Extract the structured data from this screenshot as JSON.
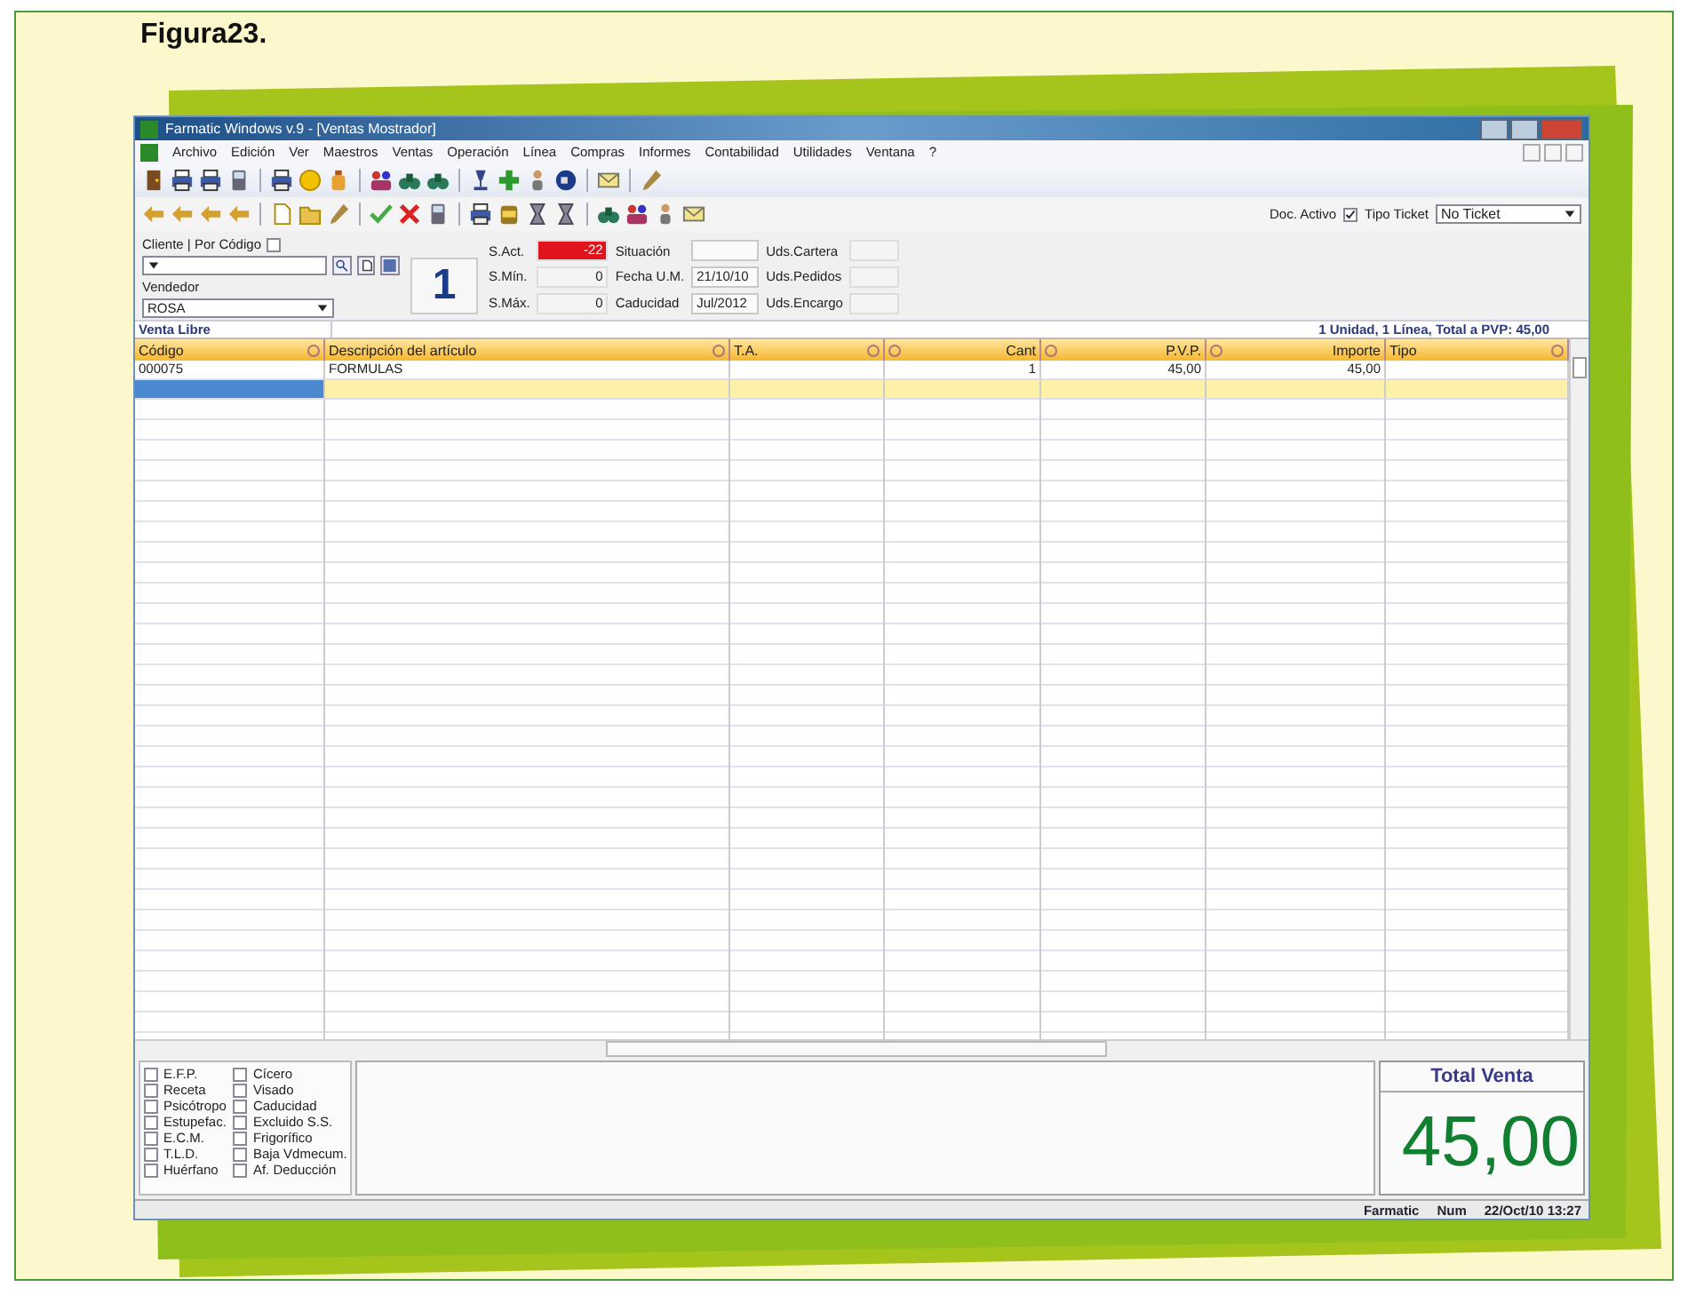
{
  "figure": {
    "caption": "Figura23."
  },
  "window": {
    "title": "Farmatic Windows v.9 - [Ventas Mostrador]"
  },
  "menu": [
    "Archivo",
    "Edición",
    "Ver",
    "Maestros",
    "Ventas",
    "Operación",
    "Línea",
    "Compras",
    "Informes",
    "Contabilidad",
    "Utilidades",
    "Ventana",
    "?"
  ],
  "doc_activo": {
    "label": "Doc. Activo",
    "checked": true
  },
  "tipo_ticket": {
    "label": "Tipo Ticket",
    "value": "No Ticket"
  },
  "cliente": {
    "label": "Cliente | Por Código",
    "checked": false
  },
  "vendedor": {
    "label": "Vendedor",
    "value": "ROSA"
  },
  "counter": "1",
  "stock": [
    {
      "label": "S.Act.",
      "value": "-22",
      "alert": true
    },
    {
      "label": "S.Mín.",
      "value": "0",
      "alert": false
    },
    {
      "label": "S.Máx.",
      "value": "0",
      "alert": false
    }
  ],
  "info": [
    {
      "label": "Situación"
    },
    {
      "label": "Fecha U.M.",
      "value": "21/10/10"
    },
    {
      "label": "Caducidad",
      "value": "Jul/2012"
    }
  ],
  "units": [
    {
      "label": "Uds.Cartera"
    },
    {
      "label": "Uds.Pedidos"
    },
    {
      "label": "Uds.Encargo"
    }
  ],
  "section": {
    "title": "Venta Libre",
    "summary": "1 Unidad, 1 Línea, Total a PVP: 45,00"
  },
  "table": {
    "columns": [
      {
        "name": "Código",
        "kind": "text"
      },
      {
        "name": "Descripción del artículo",
        "kind": "text"
      },
      {
        "name": "T.A.",
        "kind": "text"
      },
      {
        "name": "Cant",
        "kind": "number"
      },
      {
        "name": "P.V.P.",
        "kind": "number"
      },
      {
        "name": "Importe",
        "kind": "number"
      },
      {
        "name": "Tipo",
        "kind": "text"
      }
    ],
    "rows": [
      {
        "cells": [
          "000075",
          "FORMULAS",
          null,
          "1",
          "45,00",
          "45,00",
          null
        ],
        "selected": false
      },
      {
        "cells": [
          null,
          null,
          null,
          null,
          null,
          null,
          null
        ],
        "selected": true
      }
    ]
  },
  "flags": [
    {
      "label": "E.F.P.",
      "checked": false
    },
    {
      "label": "Receta",
      "checked": false
    },
    {
      "label": "Psicótropo",
      "checked": false
    },
    {
      "label": "Estupefac.",
      "checked": false
    },
    {
      "label": "E.C.M.",
      "checked": false
    },
    {
      "label": "T.L.D.",
      "checked": false
    },
    {
      "label": "Huérfano",
      "checked": false
    },
    {
      "label": "Cícero",
      "checked": false
    },
    {
      "label": "Visado",
      "checked": false
    },
    {
      "label": "Caducidad",
      "checked": false
    },
    {
      "label": "Excluido S.S.",
      "checked": false
    },
    {
      "label": "Frigorífico",
      "checked": false
    },
    {
      "label": "Baja Vdmecum.",
      "checked": false
    },
    {
      "label": "Af. Deducción",
      "checked": false
    }
  ],
  "total": {
    "label": "Total Venta",
    "value": "45,00"
  },
  "status_bar": [
    "Farmatic",
    "Num",
    "22/Oct/10 13:27"
  ]
}
